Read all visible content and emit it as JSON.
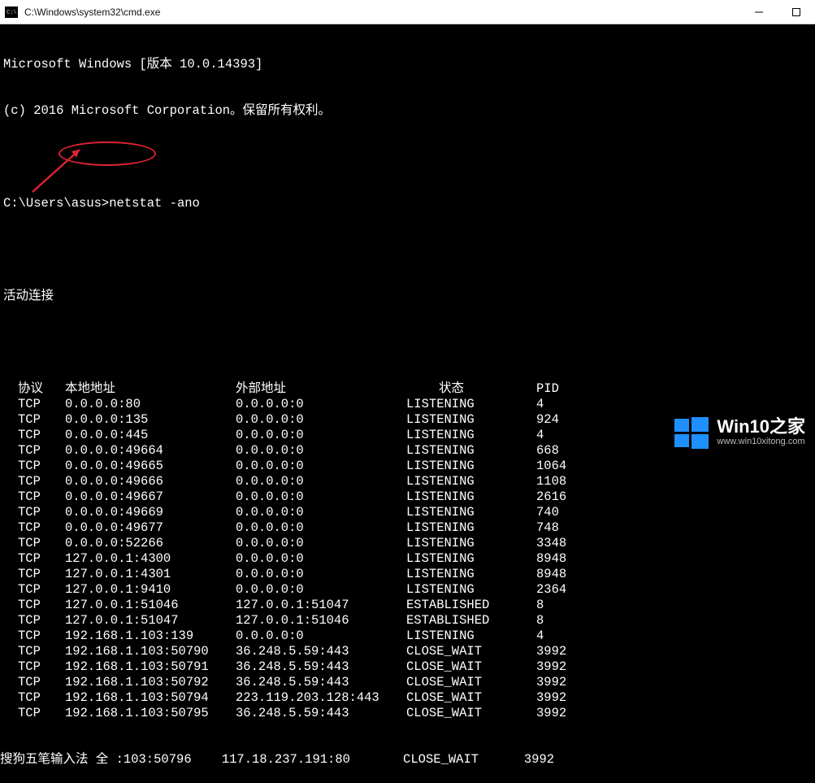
{
  "titlebar": {
    "title": "C:\\Windows\\system32\\cmd.exe"
  },
  "header": {
    "line1": "Microsoft Windows [版本 10.0.14393]",
    "line2": "(c) 2016 Microsoft Corporation。保留所有权利。",
    "prompt_prefix": "C:\\Users\\asus>",
    "command": "netstat -ano",
    "section_title": "活动连接",
    "col_proto": "协议",
    "col_local": "本地地址",
    "col_foreign": "外部地址",
    "col_state": "状态",
    "col_pid": "PID"
  },
  "rows": [
    {
      "proto": "TCP",
      "local": "0.0.0.0:80",
      "foreign": "0.0.0.0:0",
      "state": "LISTENING",
      "pid": "4"
    },
    {
      "proto": "TCP",
      "local": "0.0.0.0:135",
      "foreign": "0.0.0.0:0",
      "state": "LISTENING",
      "pid": "924"
    },
    {
      "proto": "TCP",
      "local": "0.0.0.0:445",
      "foreign": "0.0.0.0:0",
      "state": "LISTENING",
      "pid": "4"
    },
    {
      "proto": "TCP",
      "local": "0.0.0.0:49664",
      "foreign": "0.0.0.0:0",
      "state": "LISTENING",
      "pid": "668"
    },
    {
      "proto": "TCP",
      "local": "0.0.0.0:49665",
      "foreign": "0.0.0.0:0",
      "state": "LISTENING",
      "pid": "1064"
    },
    {
      "proto": "TCP",
      "local": "0.0.0.0:49666",
      "foreign": "0.0.0.0:0",
      "state": "LISTENING",
      "pid": "1108"
    },
    {
      "proto": "TCP",
      "local": "0.0.0.0:49667",
      "foreign": "0.0.0.0:0",
      "state": "LISTENING",
      "pid": "2616"
    },
    {
      "proto": "TCP",
      "local": "0.0.0.0:49669",
      "foreign": "0.0.0.0:0",
      "state": "LISTENING",
      "pid": "740"
    },
    {
      "proto": "TCP",
      "local": "0.0.0.0:49677",
      "foreign": "0.0.0.0:0",
      "state": "LISTENING",
      "pid": "748"
    },
    {
      "proto": "TCP",
      "local": "0.0.0.0:52266",
      "foreign": "0.0.0.0:0",
      "state": "LISTENING",
      "pid": "3348"
    },
    {
      "proto": "TCP",
      "local": "127.0.0.1:4300",
      "foreign": "0.0.0.0:0",
      "state": "LISTENING",
      "pid": "8948"
    },
    {
      "proto": "TCP",
      "local": "127.0.0.1:4301",
      "foreign": "0.0.0.0:0",
      "state": "LISTENING",
      "pid": "8948"
    },
    {
      "proto": "TCP",
      "local": "127.0.0.1:9410",
      "foreign": "0.0.0.0:0",
      "state": "LISTENING",
      "pid": "2364"
    },
    {
      "proto": "TCP",
      "local": "127.0.0.1:51046",
      "foreign": "127.0.0.1:51047",
      "state": "ESTABLISHED",
      "pid": "8"
    },
    {
      "proto": "TCP",
      "local": "127.0.0.1:51047",
      "foreign": "127.0.0.1:51046",
      "state": "ESTABLISHED",
      "pid": "8"
    },
    {
      "proto": "TCP",
      "local": "192.168.1.103:139",
      "foreign": "0.0.0.0:0",
      "state": "LISTENING",
      "pid": "4"
    },
    {
      "proto": "TCP",
      "local": "192.168.1.103:50790",
      "foreign": "36.248.5.59:443",
      "state": "CLOSE_WAIT",
      "pid": "3992"
    },
    {
      "proto": "TCP",
      "local": "192.168.1.103:50791",
      "foreign": "36.248.5.59:443",
      "state": "CLOSE_WAIT",
      "pid": "3992"
    },
    {
      "proto": "TCP",
      "local": "192.168.1.103:50792",
      "foreign": "36.248.5.59:443",
      "state": "CLOSE_WAIT",
      "pid": "3992"
    },
    {
      "proto": "TCP",
      "local": "192.168.1.103:50794",
      "foreign": "223.119.203.128:443",
      "state": "CLOSE_WAIT",
      "pid": "3992"
    },
    {
      "proto": "TCP",
      "local": "192.168.1.103:50795",
      "foreign": "36.248.5.59:443",
      "state": "CLOSE_WAIT",
      "pid": "3992"
    }
  ],
  "ime_line": "搜狗五笔输入法 全 :103:50796    117.18.237.191:80       CLOSE_WAIT      3992",
  "watermark": {
    "main": "Win10之家",
    "sub": "www.win10xitong.com"
  }
}
